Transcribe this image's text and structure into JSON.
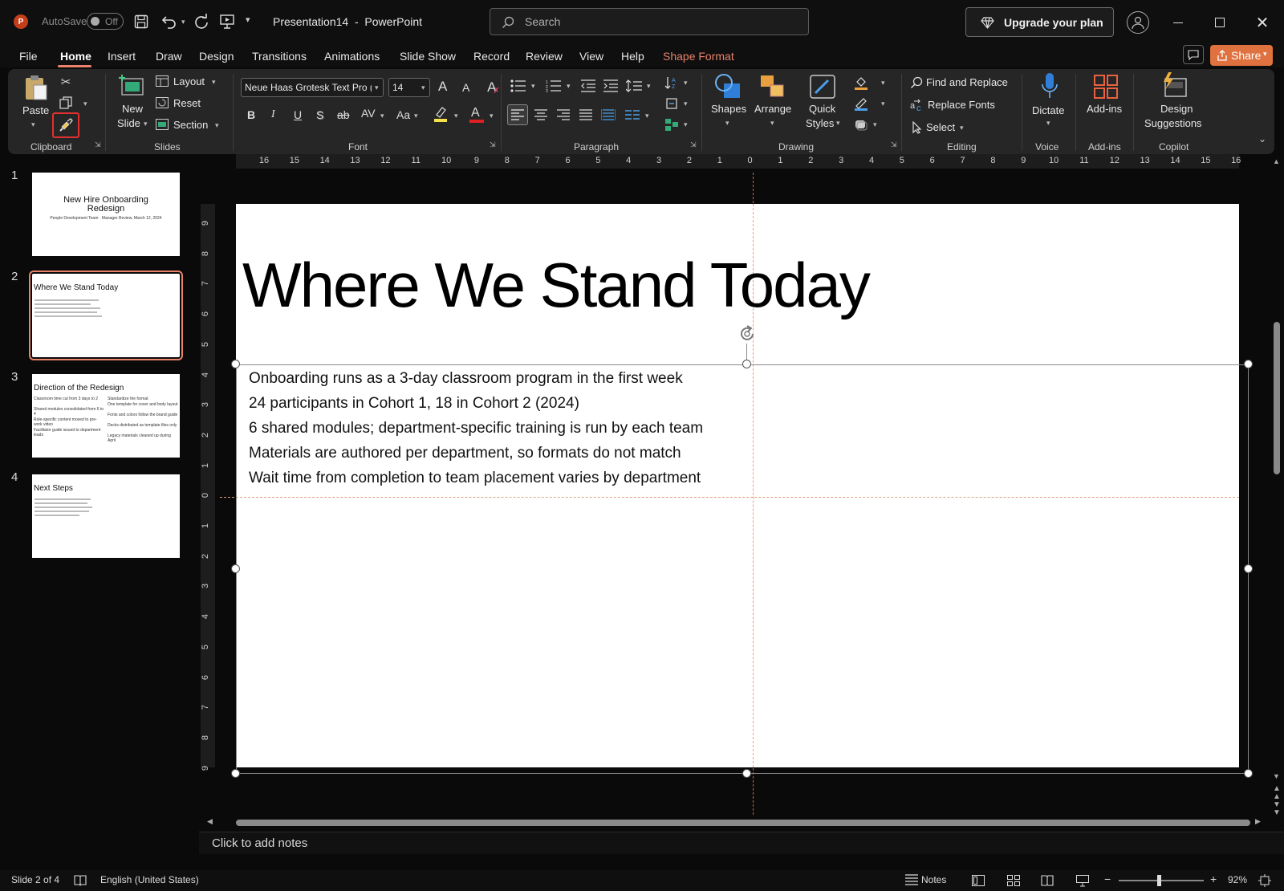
{
  "titlebar": {
    "autosave_label": "AutoSave",
    "autosave_state": "Off",
    "doc_title": "Presentation14",
    "app_name": "PowerPoint",
    "title_sep": "-",
    "search_placeholder": "Search",
    "upgrade_label": "Upgrade your plan"
  },
  "menu": {
    "tabs": [
      "File",
      "Home",
      "Insert",
      "Draw",
      "Design",
      "Transitions",
      "Animations",
      "Slide Show",
      "Record",
      "Review",
      "View",
      "Help",
      "Shape Format"
    ],
    "active": "Home",
    "share_label": "Share"
  },
  "ribbon": {
    "clipboard": {
      "paste": "Paste",
      "group": "Clipboard"
    },
    "slides": {
      "new_slide_1": "New",
      "new_slide_2": "Slide",
      "layout": "Layout",
      "reset": "Reset",
      "section": "Section",
      "group": "Slides"
    },
    "font": {
      "font_name": "Neue Haas Grotesk Text Pro (B",
      "font_size": "14",
      "group": "Font",
      "bold": "B",
      "italic": "I",
      "underline": "U",
      "shadow": "S",
      "strike": "ab",
      "spacing": "AV",
      "case": "Aa",
      "color_a": "A",
      "grow": "A",
      "shrink": "A"
    },
    "paragraph": {
      "group": "Paragraph"
    },
    "drawing": {
      "shapes": "Shapes",
      "arrange": "Arrange",
      "quick_1": "Quick",
      "quick_2": "Styles",
      "group": "Drawing"
    },
    "editing": {
      "find": "Find and Replace",
      "replace": "Replace Fonts",
      "select": "Select",
      "group": "Editing"
    },
    "voice": {
      "dictate": "Dictate",
      "group": "Voice"
    },
    "addins": {
      "label": "Add-ins",
      "group": "Add-ins"
    },
    "copilot": {
      "label_1": "Design",
      "label_2": "Suggestions",
      "group": "Copilot"
    }
  },
  "thumbnails": [
    {
      "num": "1",
      "title": "New Hire Onboarding Redesign",
      "subtitle": "People Development Team · Manager Review, March 12, 2024"
    },
    {
      "num": "2",
      "title": "Where We Stand Today"
    },
    {
      "num": "3",
      "title": "Direction of the Redesign",
      "left": [
        "Classroom time cut from 3 days to 2",
        "Shared modules consolidated from 6 to 4",
        "Role-specific content moved to pre-work video",
        "Facilitator guide issued to department leads"
      ],
      "right": [
        "Standardize the format",
        "One template for cover and body layout",
        "Fonts and colors follow the brand guide",
        "Decks distributed as template files only",
        "Legacy materials cleaned up during April"
      ]
    },
    {
      "num": "4",
      "title": "Next Steps"
    }
  ],
  "rulers": {
    "h_ticks": [
      "16",
      "15",
      "14",
      "13",
      "12",
      "11",
      "10",
      "9",
      "8",
      "7",
      "6",
      "5",
      "4",
      "3",
      "2",
      "1",
      "0",
      "1",
      "2",
      "3",
      "4",
      "5",
      "6",
      "7",
      "8",
      "9",
      "10",
      "11",
      "12",
      "13",
      "14",
      "15",
      "16"
    ],
    "v_ticks": [
      "9",
      "8",
      "7",
      "6",
      "5",
      "4",
      "3",
      "2",
      "1",
      "0",
      "1",
      "2",
      "3",
      "4",
      "5",
      "6",
      "7",
      "8",
      "9"
    ]
  },
  "slide": {
    "title": "Where We Stand Today",
    "bullets": [
      "Onboarding runs as a 3-day classroom program in the first week",
      "24 participants in Cohort 1, 18 in Cohort 2 (2024)",
      "6 shared modules; department-specific training is run by each team",
      "Materials are authored per department, so formats do not match",
      "Wait time from completion to team placement varies by department"
    ]
  },
  "notes": {
    "placeholder": "Click to add notes"
  },
  "status": {
    "slide_info": "Slide 2 of 4",
    "language": "English (United States)",
    "notes_btn": "Notes",
    "zoom": "92%"
  }
}
